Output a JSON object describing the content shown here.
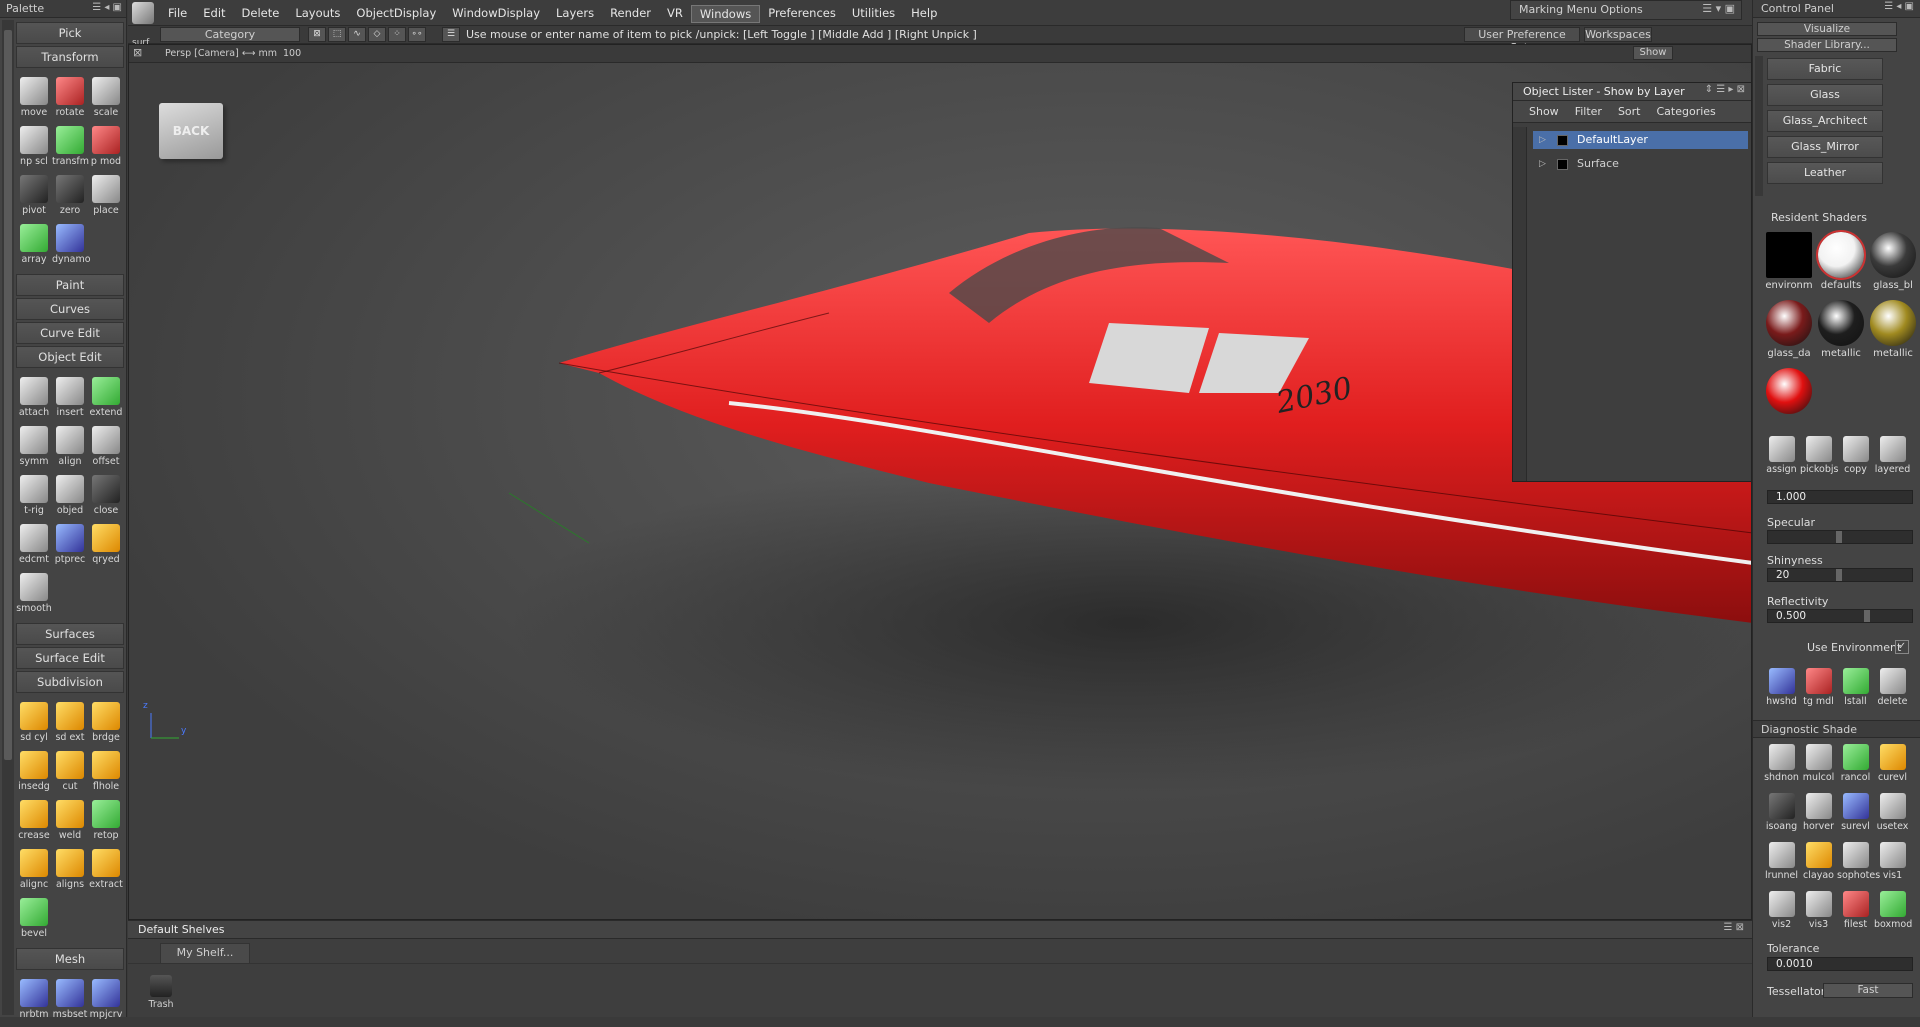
{
  "palette": {
    "title": "Palette",
    "sections": {
      "pick": "Pick",
      "transform": "Transform",
      "paint": "Paint",
      "curves": "Curves",
      "curve_edit": "Curve Edit",
      "object_edit": "Object Edit",
      "surfaces": "Surfaces",
      "surface_edit": "Surface Edit",
      "subdivision": "Subdivision",
      "mesh": "Mesh"
    },
    "transform_tools": [
      "move",
      "rotate",
      "scale",
      "np scl",
      "transfm",
      "p mod",
      "pivot",
      "zero",
      "place",
      "array",
      "dynamo"
    ],
    "object_edit_tools": [
      "attach",
      "insert",
      "extend",
      "symm",
      "align",
      "offset",
      "t-rig",
      "objed",
      "close",
      "edcmt",
      "ptprec",
      "qryed",
      "smooth"
    ],
    "subdivision_tools": [
      "sd cyl",
      "sd ext",
      "brdge",
      "insedg",
      "cut",
      "flhole",
      "crease",
      "weld",
      "retop",
      "alignc",
      "aligns",
      "extract",
      "bevel"
    ],
    "mesh_tools": [
      "nrbtm",
      "msbset",
      "mpjcrv"
    ]
  },
  "menubar": {
    "app_name": "surf",
    "items": [
      "File",
      "Edit",
      "Delete",
      "Layouts",
      "ObjectDisplay",
      "WindowDisplay",
      "Layers",
      "Render",
      "VR",
      "Windows",
      "Preferences",
      "Utilities",
      "Help"
    ],
    "active": "Windows",
    "marking_menu": "Marking Menu Options"
  },
  "toolbar2": {
    "category": "Category",
    "hint": "Use mouse or enter name of item to pick /unpick: [Left Toggle ] [Middle Add ] [Right Unpick ]",
    "user_pref_sets": "User Preference Sets",
    "workspaces": "Workspaces"
  },
  "viewport": {
    "camera": "Persp [Camera]  ⟷ mm",
    "grid_value": "100",
    "show": "Show",
    "viewcube_label": "BACK",
    "axis_z": "z",
    "axis_y": "y",
    "model_text": "2030"
  },
  "object_lister": {
    "title": "Object Lister - Show by Layer",
    "tabs": [
      "Show",
      "Filter",
      "Sort",
      "Categories"
    ],
    "rows": [
      "DefaultLayer",
      "Surface"
    ]
  },
  "control_panel": {
    "title": "Control Panel",
    "mode": "Visualize",
    "shader_library": "Shader Library...",
    "library_items": [
      "Fabric",
      "Glass",
      "Glass_Architect",
      "Glass_Mirror",
      "Leather"
    ],
    "resident_title": "Resident Shaders",
    "resident_shaders": [
      {
        "label": "environm",
        "color": "#000000"
      },
      {
        "label": "defaults",
        "color": "#f2f2f2"
      },
      {
        "label": "glass_bl",
        "color": "#3a3a3a"
      },
      {
        "label": "glass_da",
        "color": "#7a1b1b"
      },
      {
        "label": "metallic",
        "color": "#1e1e1e"
      },
      {
        "label": "metallic",
        "color": "#a08a20"
      },
      {
        "label": "",
        "color": "#e01010"
      }
    ],
    "shader_tools": [
      "assign",
      "pickobjs",
      "copy",
      "layered"
    ],
    "value_1": "1.000",
    "specular_label": "Specular",
    "shininess_label": "Shinyness",
    "shininess_value": "20",
    "reflectivity_label": "Reflectivity",
    "reflectivity_value": "0.500",
    "use_env": "Use Environment",
    "bottom_tools": [
      "hwshd",
      "tg mdl",
      "lstall",
      "delete"
    ],
    "diag_title": "Diagnostic Shade",
    "diag_tools": [
      "shdnon",
      "mulcol",
      "rancol",
      "curevl",
      "isoang",
      "horver",
      "surevl",
      "usetex",
      "lrunnel",
      "clayao",
      "sophotes",
      "vis1",
      "vis2",
      "vis3",
      "filest",
      "boxmod"
    ],
    "tolerance_label": "Tolerance",
    "tolerance_value": "0.0010",
    "tessellator_label": "Tessellator",
    "tessellator_value": "Fast"
  },
  "shelves": {
    "title": "Default Shelves",
    "tab": "My Shelf...",
    "trash": "Trash"
  }
}
